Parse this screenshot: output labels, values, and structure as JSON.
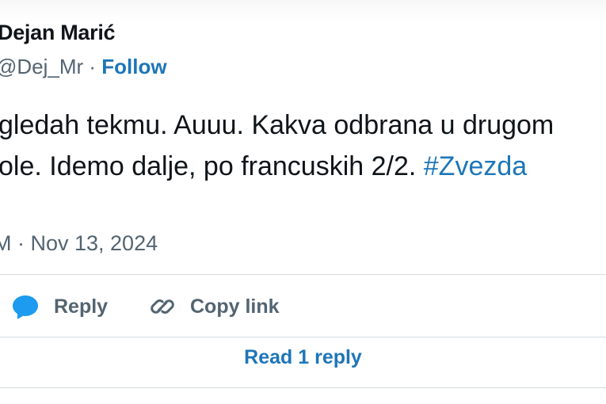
{
  "tweet": {
    "author_name": "Dejan Marić",
    "handle": "@Dej_Mr",
    "separator": " · ",
    "follow_label": "Follow",
    "text_line_1": "gledah tekmu. Auuu. Kakva odbrana u drugom",
    "text_line_2_prefix": "ole. Idemo dalje, po francuskih 2/2. ",
    "hashtag": "#Zvezda",
    "timestamp": "M · Nov 13, 2024"
  },
  "actions": {
    "reply_label": "Reply",
    "copy_link_label": "Copy link",
    "read_replies_label": "Read 1 reply"
  },
  "colors": {
    "accent": "#1d76b8",
    "secondary_text": "#536471",
    "primary_text": "#0f1419",
    "reply_icon": "#1d9bf0",
    "divider": "#d4dadd"
  },
  "icons": {
    "reply": "speech-bubble-icon",
    "copy_link": "link-icon"
  }
}
